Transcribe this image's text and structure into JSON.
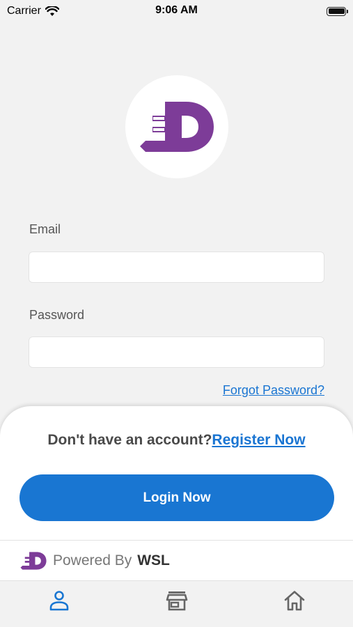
{
  "status_bar": {
    "carrier": "Carrier",
    "time": "9:06 AM"
  },
  "form": {
    "email_label": "Email",
    "email_value": "",
    "password_label": "Password",
    "password_value": "",
    "forgot_password": "Forgot Password?"
  },
  "footer": {
    "no_account_text": "Don't have an account?",
    "register_link": "Register Now",
    "login_button": "Login Now",
    "powered_by": "Powered By",
    "brand": "WSL"
  },
  "tabs": [
    {
      "icon": "user-icon",
      "active": true
    },
    {
      "icon": "store-icon",
      "active": false
    },
    {
      "icon": "home-icon",
      "active": false
    }
  ],
  "colors": {
    "brand_purple": "#7d3c98",
    "accent_blue": "#1976d2",
    "link_blue": "#1a75d2"
  }
}
